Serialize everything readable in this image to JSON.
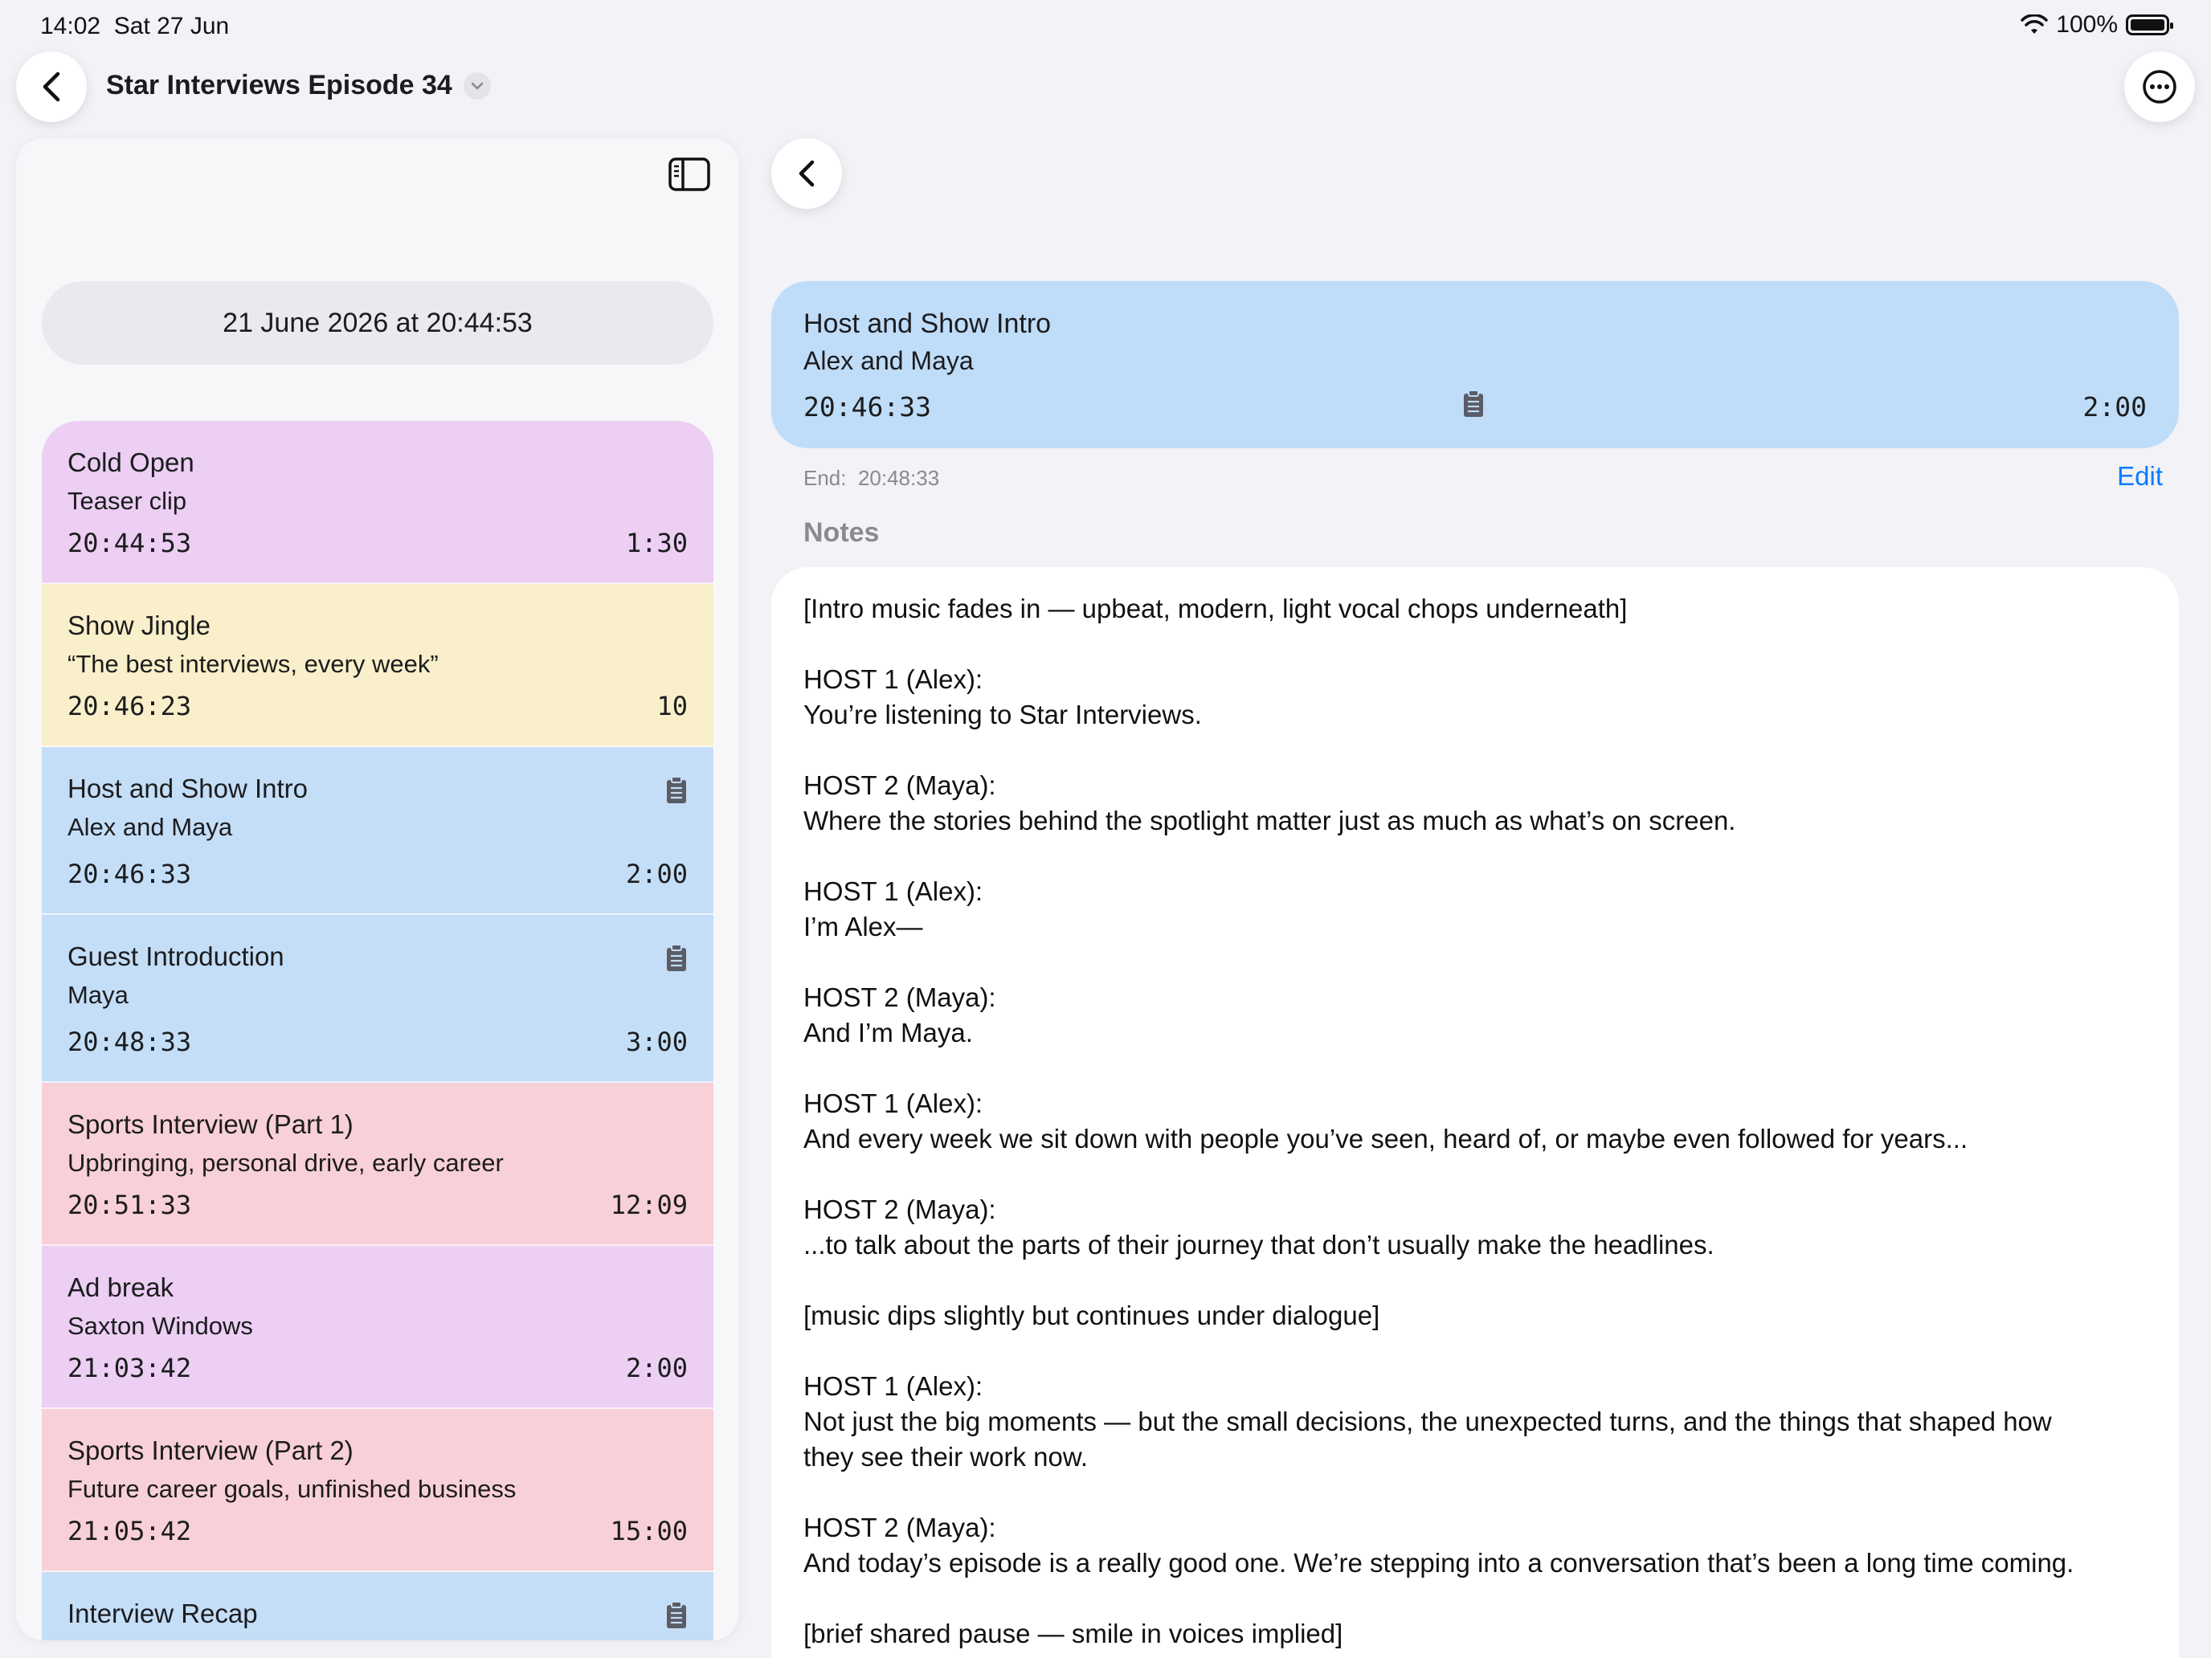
{
  "status_bar": {
    "time": "14:02",
    "date": "Sat 27 Jun",
    "battery": "100%"
  },
  "nav": {
    "title": "Star Interviews Episode 34"
  },
  "left_panel": {
    "start_date": "21 June 2026 at 20:44:53",
    "segments": [
      {
        "title": "Cold Open",
        "subtitle": "Teaser clip",
        "start": "20:44:53",
        "duration": "1:30",
        "color": "#eccff3",
        "has_notes": false
      },
      {
        "title": "Show Jingle",
        "subtitle": "“The best interviews, every week”",
        "start": "20:46:23",
        "duration": "10",
        "color": "#f9efca",
        "has_notes": false
      },
      {
        "title": "Host and Show Intro",
        "subtitle": "Alex and Maya",
        "start": "20:46:33",
        "duration": "2:00",
        "color": "#c4def8",
        "has_notes": true
      },
      {
        "title": "Guest Introduction",
        "subtitle": "Maya",
        "start": "20:48:33",
        "duration": "3:00",
        "color": "#c4def8",
        "has_notes": true
      },
      {
        "title": "Sports Interview (Part 1)",
        "subtitle": "Upbringing, personal drive, early career",
        "start": "20:51:33",
        "duration": "12:09",
        "color": "#f8d0d7",
        "has_notes": false
      },
      {
        "title": "Ad break",
        "subtitle": "Saxton Windows",
        "start": "21:03:42",
        "duration": "2:00",
        "color": "#eccff3",
        "has_notes": false
      },
      {
        "title": "Sports Interview (Part 2)",
        "subtitle": "Future career goals, unfinished business",
        "start": "21:05:42",
        "duration": "15:00",
        "color": "#f8d0d7",
        "has_notes": false
      },
      {
        "title": "Interview Recap",
        "subtitle": "",
        "start": "",
        "duration": "",
        "color": "#c4def8",
        "has_notes": true
      }
    ]
  },
  "detail": {
    "title": "Host and Show Intro",
    "subtitle": "Alex and Maya",
    "start": "20:46:33",
    "duration": "2:00",
    "end_label": "End:",
    "end_time": "20:48:33",
    "edit_label": "Edit",
    "notes_label": "Notes",
    "notes": [
      "[Intro music fades in — upbeat, modern, light vocal chops underneath]",
      "HOST 1 (Alex):\nYou’re listening to Star Interviews.",
      "HOST 2 (Maya):\nWhere the stories behind the spotlight matter just as much as what’s on screen.",
      "HOST 1 (Alex):\nI’m Alex—",
      "HOST 2 (Maya):\nAnd I’m Maya.",
      "HOST 1 (Alex):\nAnd every week we sit down with people you’ve seen, heard of, or maybe even followed for years...",
      "HOST 2 (Maya):\n...to talk about the parts of their journey that don’t usually make the headlines.",
      "[music dips slightly but continues under dialogue]",
      "HOST 1 (Alex):\nNot just the big moments — but the small decisions, the unexpected turns, and the things that shaped how\nthey see their work now.",
      "HOST 2 (Maya):\nAnd today’s episode is a really good one. We’re stepping into a conversation that’s been a long time coming.",
      "[brief shared pause — smile in voices implied]"
    ]
  }
}
